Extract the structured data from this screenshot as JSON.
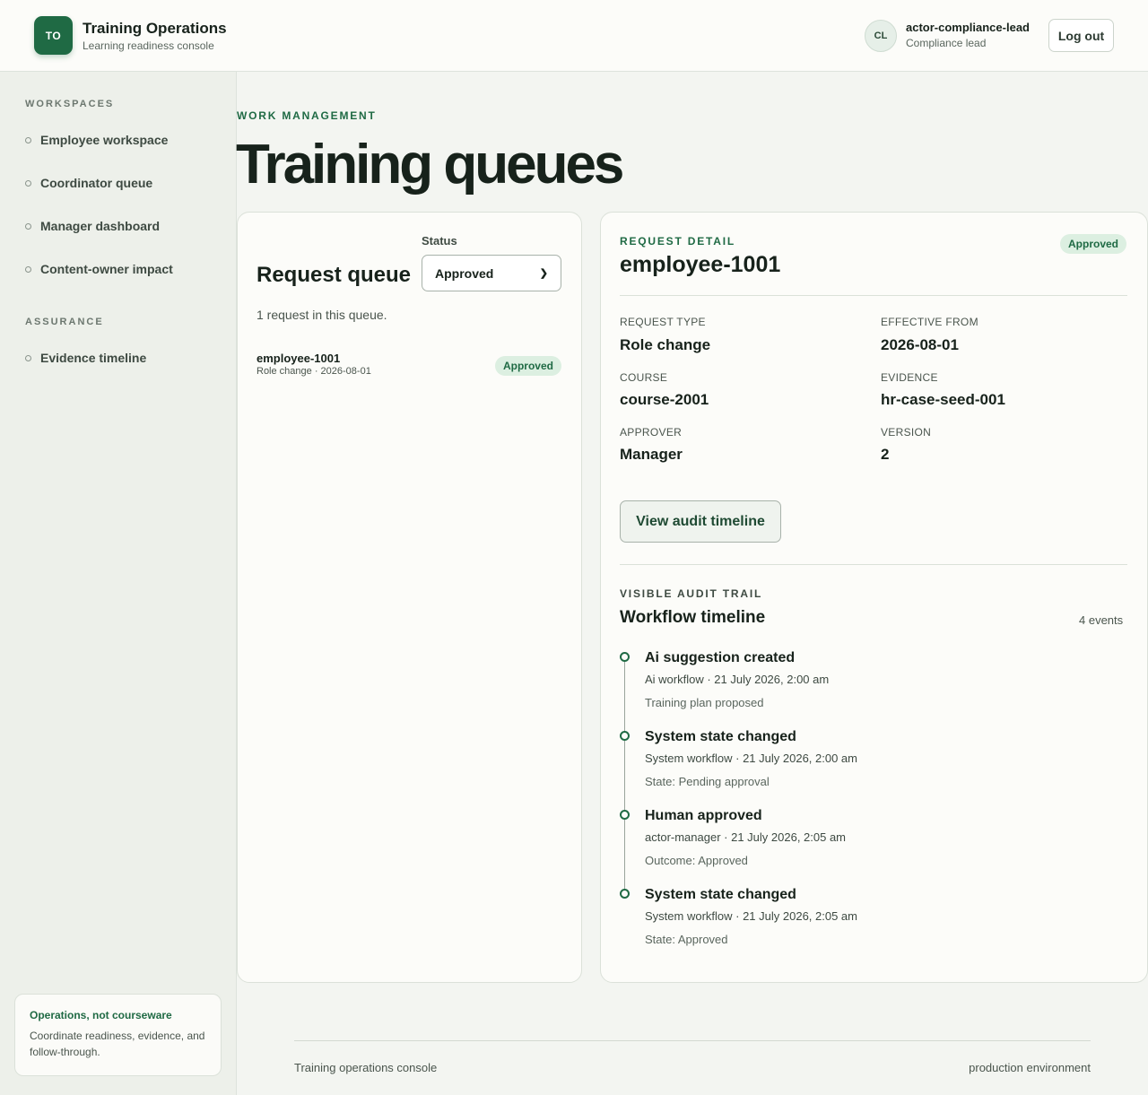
{
  "header": {
    "badge": "TO",
    "title": "Training Operations",
    "subtitle": "Learning readiness console",
    "user_initials": "CL",
    "user_name": "actor-compliance-lead",
    "user_role": "Compliance lead",
    "logout_label": "Log out"
  },
  "sidebar": {
    "workspaces_label": "WORKSPACES",
    "workspaces": [
      {
        "label": "Employee workspace"
      },
      {
        "label": "Coordinator queue"
      },
      {
        "label": "Manager dashboard"
      },
      {
        "label": "Content-owner impact"
      }
    ],
    "assurance_label": "ASSURANCE",
    "assurance": [
      {
        "label": "Evidence timeline"
      }
    ],
    "card": {
      "title": "Operations, not courseware",
      "text": "Coordinate readiness, evidence, and follow-through."
    }
  },
  "main": {
    "eyebrow": "WORK MANAGEMENT",
    "title": "Training queues"
  },
  "queue": {
    "title": "Request queue",
    "status_label": "Status",
    "status_value": "Approved",
    "count_text": "1 request in this queue.",
    "requests": [
      {
        "id": "employee-1001",
        "meta": "Role change · 2026-08-01",
        "status": "Approved"
      }
    ]
  },
  "detail": {
    "eyebrow": "REQUEST DETAIL",
    "status": "Approved",
    "id": "employee-1001",
    "fields": {
      "request_type_label": "REQUEST TYPE",
      "request_type": "Role change",
      "effective_from_label": "EFFECTIVE FROM",
      "effective_from": "2026-08-01",
      "course_label": "COURSE",
      "course": "course-2001",
      "evidence_label": "EVIDENCE",
      "evidence": "hr-case-seed-001",
      "approver_label": "APPROVER",
      "approver": "Manager",
      "version_label": "VERSION",
      "version": "2"
    },
    "audit_button": "View audit timeline",
    "audit_eyebrow": "VISIBLE AUDIT TRAIL",
    "timeline_title": "Workflow timeline",
    "events_count": "4 events",
    "events": [
      {
        "title": "Ai suggestion created",
        "meta": "Ai workflow · 21 July 2026, 2:00 am",
        "note": "Training plan proposed"
      },
      {
        "title": "System state changed",
        "meta": "System workflow · 21 July 2026, 2:00 am",
        "note": "State: Pending approval"
      },
      {
        "title": "Human approved",
        "meta": "actor-manager · 21 July 2026, 2:05 am",
        "note": "Outcome: Approved"
      },
      {
        "title": "System state changed",
        "meta": "System workflow · 21 July 2026, 2:05 am",
        "note": "State: Approved"
      }
    ]
  },
  "footer": {
    "left": "Training operations console",
    "right": "production environment"
  },
  "colors": {
    "accent": "#1f6a44",
    "badge_bg": "#dcefe1",
    "sidebar_bg": "#edf0ea",
    "page_bg": "#f3f5f1"
  }
}
